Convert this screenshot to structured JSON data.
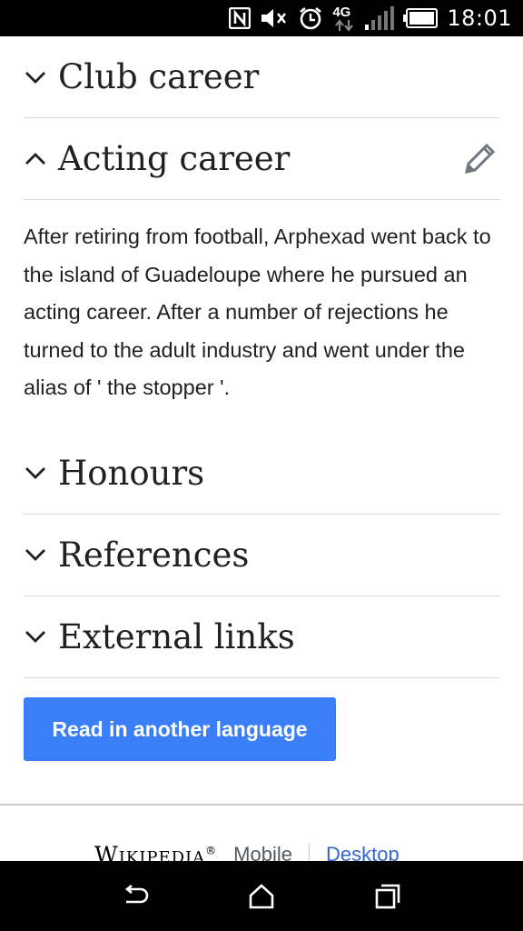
{
  "status_bar": {
    "time": "18:01",
    "network_label": "4G",
    "icons": [
      "nfc-icon",
      "mute-icon",
      "alarm-icon",
      "network-4g-icon",
      "signal-icon",
      "battery-icon"
    ]
  },
  "sections": [
    {
      "title": "Club career",
      "expanded": false
    },
    {
      "title": "Acting career",
      "expanded": true,
      "body": "After retiring from football, Arphexad went back to the island of Guadeloupe where he pursued an acting career. After a number of rejections he turned to the adult industry and went under the alias of ' the stopper '."
    },
    {
      "title": "Honours",
      "expanded": false
    },
    {
      "title": "References",
      "expanded": false
    },
    {
      "title": "External links",
      "expanded": false
    }
  ],
  "read_language_button": "Read in another language",
  "footer": {
    "wordmark": "Wikipedia",
    "mobile": "Mobile",
    "desktop": "Desktop"
  },
  "colors": {
    "accent": "#3a7ff7",
    "link": "#3366cc",
    "divider": "#d9dadc"
  }
}
